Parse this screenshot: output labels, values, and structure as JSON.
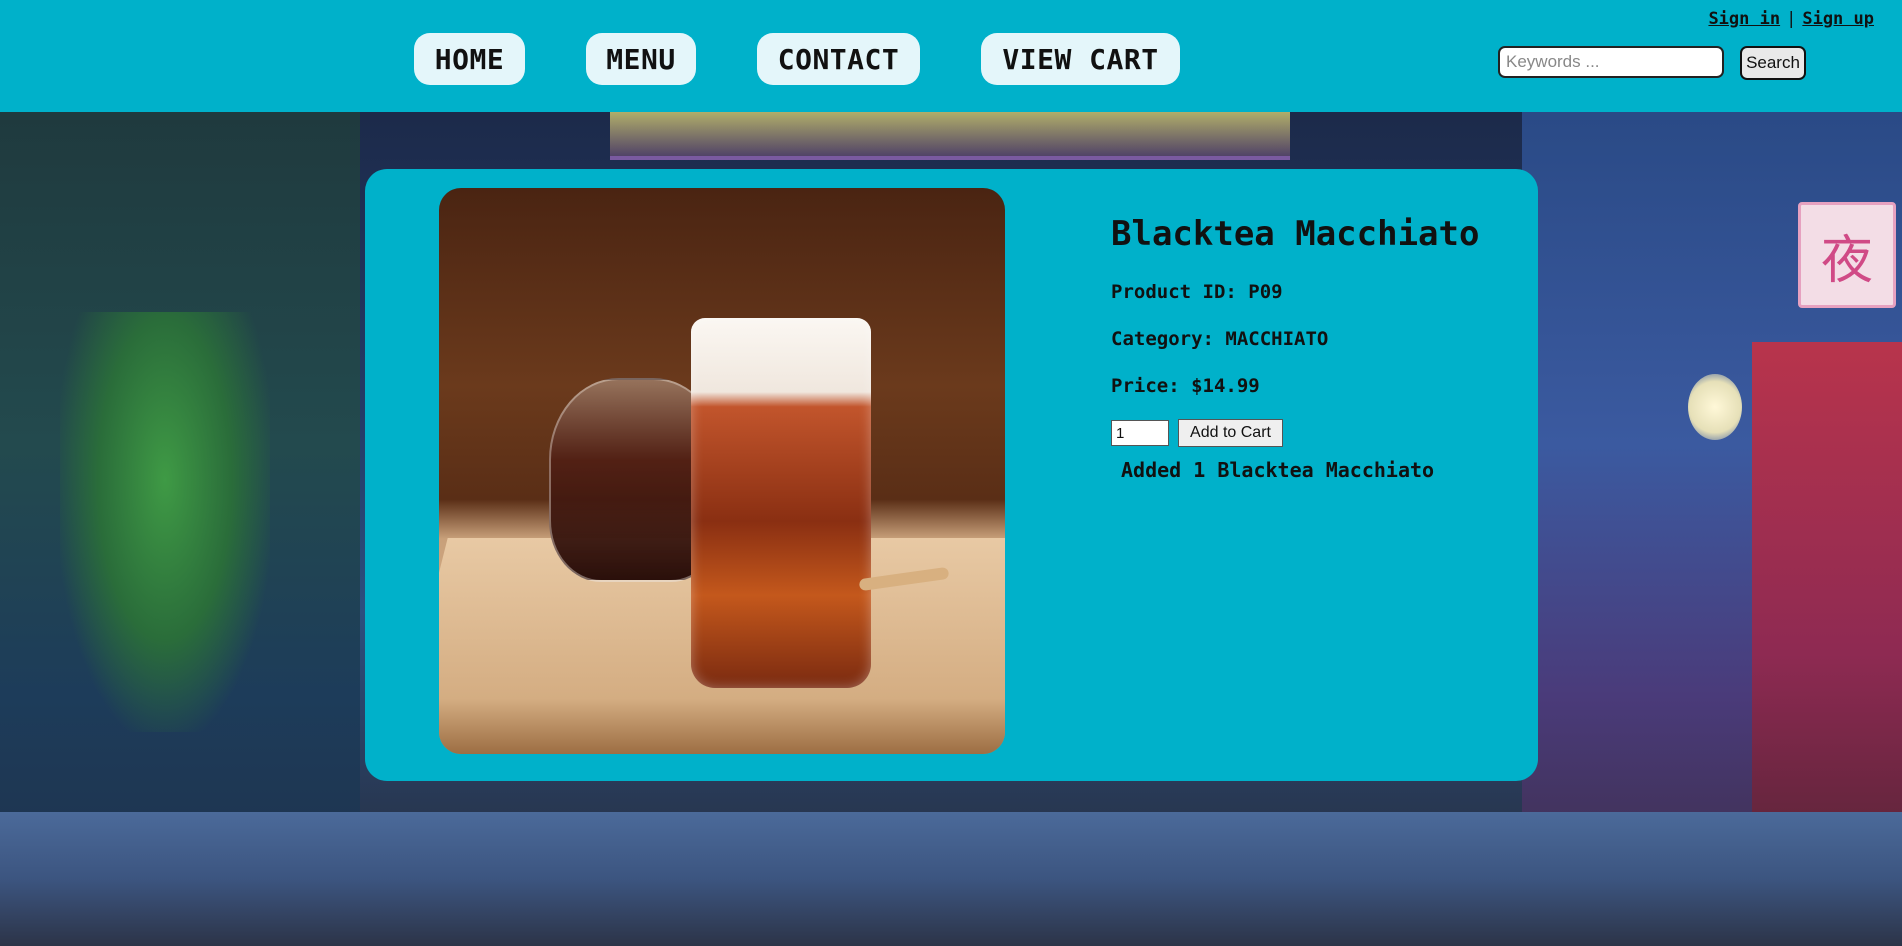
{
  "nav": {
    "home": "HOME",
    "menu": "MENU",
    "contact": "CONTACT",
    "view_cart": "VIEW CART"
  },
  "auth": {
    "sign_in": "Sign in",
    "separator": "|",
    "sign_up": "Sign up"
  },
  "search": {
    "placeholder": "Keywords ...",
    "button": "Search"
  },
  "product": {
    "title": "Blacktea Macchiato",
    "id_line": "Product ID: P09",
    "category_line": "Category: MACCHIATO",
    "price_line": "Price: $14.99",
    "quantity": "1",
    "add_button": "Add to Cart",
    "added_message": "Added 1 Blacktea Macchiato"
  },
  "scene": {
    "sign_glyph": "夜"
  },
  "colors": {
    "header_bg": "#00b1ca",
    "card_bg": "#00b1ca",
    "nav_button_bg": "#e4f6fa"
  }
}
